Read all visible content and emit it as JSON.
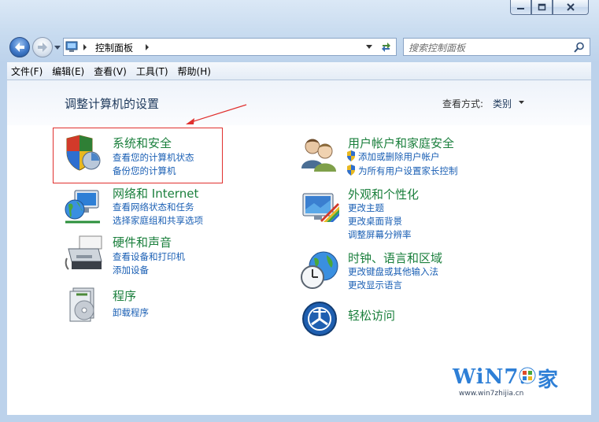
{
  "window": {
    "caption_buttons": [
      "minimize-icon",
      "restore-icon",
      "close-icon"
    ]
  },
  "nav": {
    "back_icon": "back-arrow-icon",
    "forward_icon": "forward-arrow-icon",
    "breadcrumb": [
      "控制面板"
    ],
    "search_placeholder": "搜索控制面板"
  },
  "menu": {
    "items": [
      "文件(F)",
      "编辑(E)",
      "查看(V)",
      "工具(T)",
      "帮助(H)"
    ]
  },
  "header": {
    "title": "调整计算机的设置",
    "view_label": "查看方式:",
    "view_value": "类别"
  },
  "categories_left": [
    {
      "title": "系统和安全",
      "links": [
        "查看您的计算机状态",
        "备份您的计算机"
      ],
      "icon": "shield-security-icon"
    },
    {
      "title": "网络和 Internet",
      "links": [
        "查看网络状态和任务",
        "选择家庭组和共享选项"
      ],
      "icon": "network-globe-icon"
    },
    {
      "title": "硬件和声音",
      "links": [
        "查看设备和打印机",
        "添加设备"
      ],
      "icon": "printer-icon"
    },
    {
      "title": "程序",
      "links": [
        "卸载程序"
      ],
      "icon": "programs-icon"
    }
  ],
  "categories_right": [
    {
      "title": "用户帐户和家庭安全",
      "links": [
        "添加或删除用户帐户",
        "为所有用户设置家长控制"
      ],
      "icon": "users-icon"
    },
    {
      "title": "外观和个性化",
      "links": [
        "更改主题",
        "更改桌面背景",
        "调整屏幕分辨率"
      ],
      "icon": "appearance-icon"
    },
    {
      "title": "时钟、语言和区域",
      "links": [
        "更改键盘或其他输入法",
        "更改显示语言"
      ],
      "icon": "clock-globe-icon"
    },
    {
      "title": "轻松访问",
      "links": [],
      "icon": "ease-of-access-icon"
    }
  ],
  "watermark": {
    "logo_text": "WiN7.",
    "logo_suffix": "家",
    "url": "www.win7zhijia.cn"
  },
  "colors": {
    "title_green": "#1a7f3c",
    "link_blue": "#1a5fb4",
    "highlight_red": "#e0302e"
  }
}
